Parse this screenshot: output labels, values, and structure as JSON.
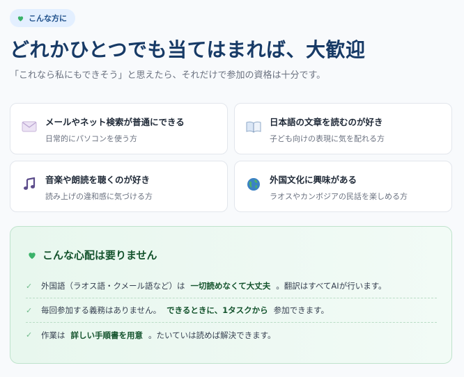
{
  "badge": {
    "label": "こんな方に",
    "icon": "green-heart-icon"
  },
  "title": "どれかひとつでも当てはまれば、大歓迎",
  "subtitle": "「これなら私にもできそう」と思えたら、それだけで参加の資格は十分です。",
  "cards": [
    {
      "icon": "envelope-icon",
      "title": "メールやネット検索が普通にできる",
      "sub": "日常的にパソコンを使う方"
    },
    {
      "icon": "open-book-icon",
      "title": "日本語の文章を読むのが好き",
      "sub": "子ども向けの表現に気を配れる方"
    },
    {
      "icon": "music-note-icon",
      "title": "音楽や朗読を聴くのが好き",
      "sub": "読み上げの違和感に気づける方"
    },
    {
      "icon": "globe-icon",
      "title": "外国文化に興味がある",
      "sub": "ラオスやカンボジアの民話を楽しめる方"
    }
  ],
  "worry": {
    "title": "こんな心配は要りません",
    "icon": "green-heart-icon",
    "items": [
      {
        "pre": "外国語（ラオス語・クメール語など）は",
        "em": "一切読めなくて大丈夫",
        "post": "。翻訳はすべてAIが行います。"
      },
      {
        "pre": "毎回参加する義務はありません。",
        "em": "できるときに、1タスクから",
        "post": "参加できます。"
      },
      {
        "pre": "作業は",
        "em": "詳しい手順書を用意",
        "post": "。たいていは読めば解決できます。"
      }
    ],
    "check": "✓"
  },
  "colors": {
    "accent": "#173a66",
    "green": "#14532d",
    "badge_bg": "#e3efff"
  }
}
